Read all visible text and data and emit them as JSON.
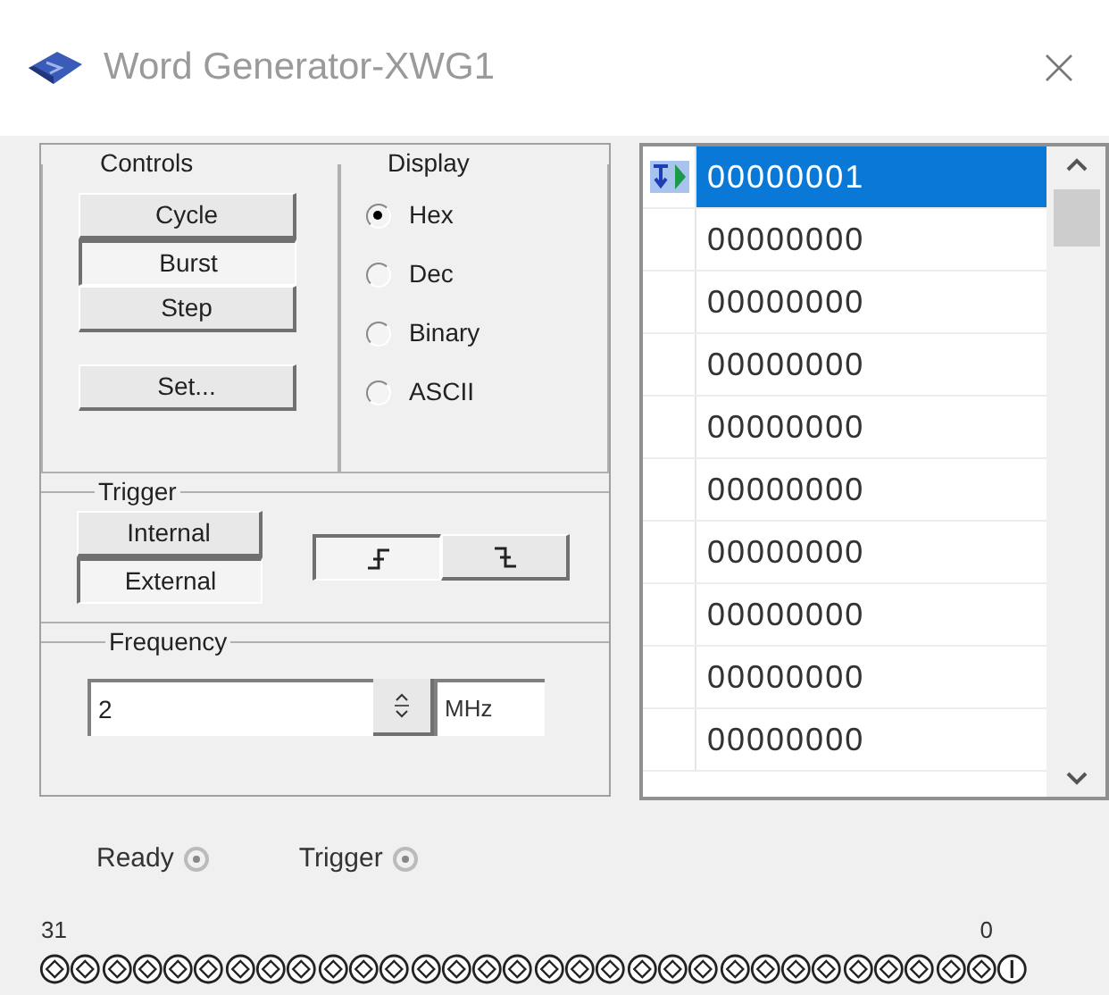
{
  "window": {
    "title": "Word Generator-XWG1"
  },
  "controls": {
    "title": "Controls",
    "buttons": [
      {
        "label": "Cycle",
        "selected": false
      },
      {
        "label": "Burst",
        "selected": true
      },
      {
        "label": "Step",
        "selected": false
      },
      {
        "label": "Set...",
        "selected": false
      }
    ]
  },
  "display": {
    "title": "Display",
    "options": [
      {
        "label": "Hex",
        "selected": true
      },
      {
        "label": "Dec",
        "selected": false
      },
      {
        "label": "Binary",
        "selected": false
      },
      {
        "label": "ASCII",
        "selected": false
      }
    ]
  },
  "trigger": {
    "title": "Trigger",
    "sources": [
      {
        "label": "Internal",
        "selected": false
      },
      {
        "label": "External",
        "selected": true
      }
    ],
    "edges": [
      {
        "kind": "rising",
        "selected": true
      },
      {
        "kind": "falling",
        "selected": false
      }
    ]
  },
  "frequency": {
    "title": "Frequency",
    "value": "2",
    "unit": "MHz"
  },
  "words": [
    {
      "value": "00000001",
      "selected": true
    },
    {
      "value": "00000000",
      "selected": false
    },
    {
      "value": "00000000",
      "selected": false
    },
    {
      "value": "00000000",
      "selected": false
    },
    {
      "value": "00000000",
      "selected": false
    },
    {
      "value": "00000000",
      "selected": false
    },
    {
      "value": "00000000",
      "selected": false
    },
    {
      "value": "00000000",
      "selected": false
    },
    {
      "value": "00000000",
      "selected": false
    },
    {
      "value": "00000000",
      "selected": false
    }
  ],
  "indicators": [
    {
      "label": "Ready"
    },
    {
      "label": "Trigger"
    }
  ],
  "bits": {
    "high_label": "31",
    "low_label": "0",
    "pins": [
      {
        "on": false
      },
      {
        "on": false
      },
      {
        "on": false
      },
      {
        "on": false
      },
      {
        "on": false
      },
      {
        "on": false
      },
      {
        "on": false
      },
      {
        "on": false
      },
      {
        "on": false
      },
      {
        "on": false
      },
      {
        "on": false
      },
      {
        "on": false
      },
      {
        "on": false
      },
      {
        "on": false
      },
      {
        "on": false
      },
      {
        "on": false
      },
      {
        "on": false
      },
      {
        "on": false
      },
      {
        "on": false
      },
      {
        "on": false
      },
      {
        "on": false
      },
      {
        "on": false
      },
      {
        "on": false
      },
      {
        "on": false
      },
      {
        "on": false
      },
      {
        "on": false
      },
      {
        "on": false
      },
      {
        "on": false
      },
      {
        "on": false
      },
      {
        "on": false
      },
      {
        "on": false
      },
      {
        "on": true
      }
    ]
  }
}
